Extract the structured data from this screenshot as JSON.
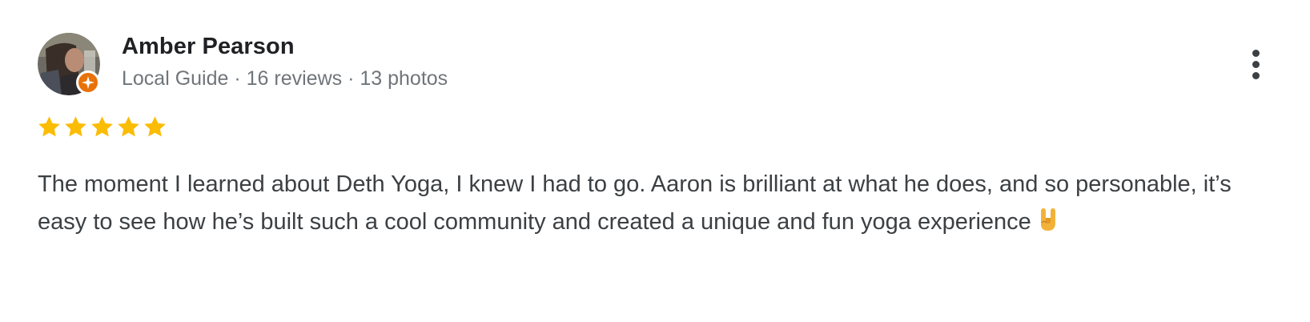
{
  "reviewer": {
    "name": "Amber Pearson",
    "meta": "Local Guide · 16 reviews · 13 photos"
  },
  "rating": {
    "stars": 5,
    "max": 5,
    "color": "#fbbc04"
  },
  "review": {
    "text": "The moment I learned about Deth Yoga, I knew I had to go. Aaron is brilliant at what he does, and so personable, it’s easy to see how he’s built such a cool community and created a unique and fun yoga experience"
  },
  "icons": {
    "badge": "local-guide-badge-icon",
    "more": "more-vert-icon",
    "emoji": "sign-of-the-horns-emoji"
  },
  "colors": {
    "name": "#202124",
    "meta": "#70757a",
    "text": "#3c4043",
    "badge": "#e8710a"
  }
}
